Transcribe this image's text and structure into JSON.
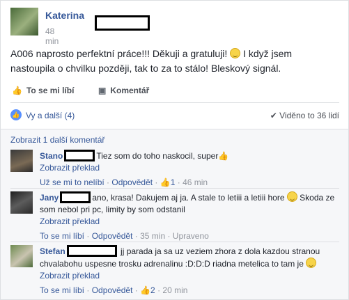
{
  "post": {
    "author": "Katerina",
    "time": "48 min",
    "text_a": "A006 naprosto perfektní práce!!! Děkuji a gratuluji! ",
    "text_b": " I když jsem nastoupila o chvilku později, tak to za to stálo! Bleskový signál."
  },
  "actions": {
    "like": "To se mi líbí",
    "comment": "Komentář"
  },
  "reactions": {
    "text": "Vy a další (4)",
    "seen": "Viděno to 36 lidí"
  },
  "comments_header": "Zobrazit 1 další komentář",
  "comments": [
    {
      "name": "Stano",
      "text": "Tiez som do toho naskocil, super",
      "translate": "Zobrazit překlad",
      "unlike": "Už se mi to nelíbí",
      "reply": "Odpovědět",
      "likes": "1",
      "time": "46 min"
    },
    {
      "name": "Jany",
      "text_a": "ano, krasa! Dakujem aj ja. A stale to letiii a letiii hore ",
      "text_b": " Skoda ze som nebol pri pc, limity by som odstanil",
      "translate": "Zobrazit překlad",
      "like": "To se mi líbí",
      "reply": "Odpovědět",
      "time": "35 min",
      "edited": "Upraveno"
    },
    {
      "name": "Stefan",
      "text_a": " jj parada ja sa uz veziem zhora z dola kazdou stranou chvalabohu uspesne trosku adrenalinu :D:D:D riadna metelica to tam je ",
      "translate": "Zobrazit překlad",
      "like": "To se mi líbí",
      "reply": "Odpovědět",
      "likes": "2",
      "time": "20 min"
    }
  ],
  "colors": {
    "link": "#365899",
    "meta": "#90949c",
    "like_blue": "#5890ff"
  },
  "icons": [
    "thumbs-up-icon",
    "comment-icon",
    "like-badge-icon",
    "checkmark-icon",
    "smiley-icon"
  ]
}
